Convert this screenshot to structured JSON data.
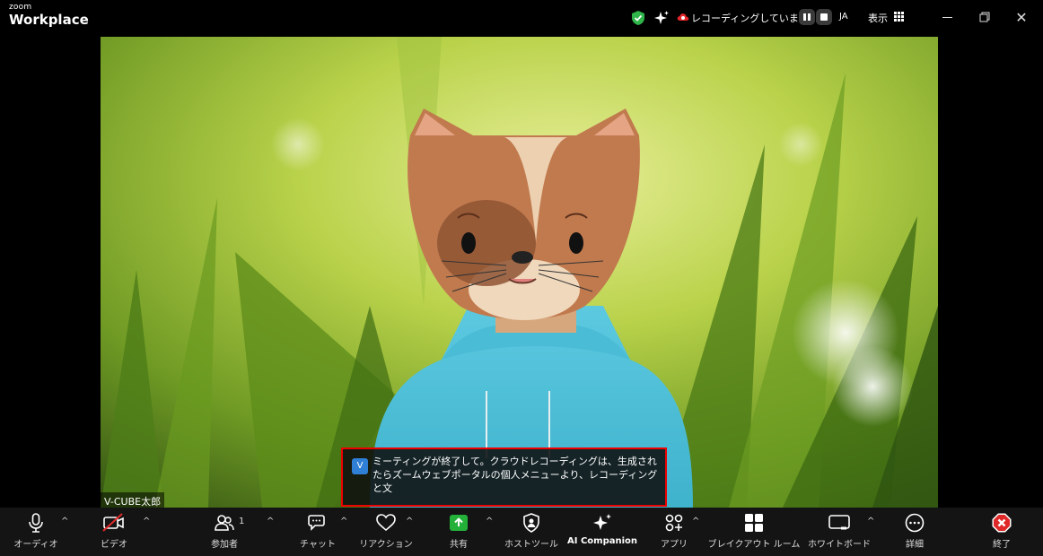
{
  "titlebar": {
    "brand_small": "zoom",
    "brand_big": "Workplace",
    "recording_text": "レコーディングしています...",
    "language": "JA",
    "view_label": "表示"
  },
  "video": {
    "participant_name": "V-CUBE太郎"
  },
  "caption": {
    "avatar_letter": "V",
    "text": "ミーティングが終了して。クラウドレコーディングは、生成されたらズームウェブポータルの個人メニューより、レコーディングと文"
  },
  "toolbar": {
    "audio": "オーディオ",
    "video": "ビデオ",
    "participants": "参加者",
    "participants_count": "1",
    "chat": "チャット",
    "reactions": "リアクション",
    "share": "共有",
    "host_tools": "ホストツール",
    "ai_companion": "AI Companion",
    "apps": "アプリ",
    "breakout": "ブレイクアウト ルーム",
    "whiteboard": "ホワイトボード",
    "more": "詳細",
    "end": "終了"
  },
  "colors": {
    "accent_green": "#23b13a",
    "end_red": "#e02828",
    "caption_border": "#e00000",
    "shield_green": "#2fb54a"
  }
}
